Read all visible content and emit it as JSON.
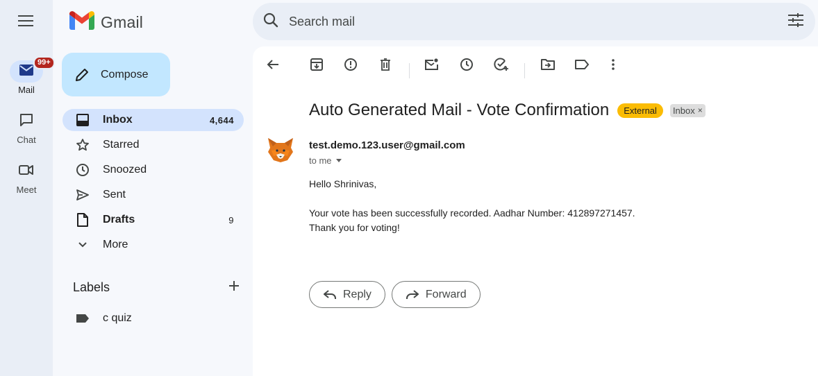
{
  "app": {
    "name": "Gmail",
    "brand_colors": {
      "red": "#ea4335",
      "blue": "#4285f4",
      "green": "#34a853",
      "yellow": "#fbbc04"
    }
  },
  "rail": {
    "menu_icon": "hamburger-menu-icon",
    "items": [
      {
        "label": "Mail",
        "icon": "mail-icon",
        "badge": "99+",
        "active": true
      },
      {
        "label": "Chat",
        "icon": "chat-icon"
      },
      {
        "label": "Meet",
        "icon": "video-camera-icon"
      }
    ]
  },
  "search": {
    "placeholder": "Search mail",
    "icon": "search-icon",
    "filter_icon": "filter-sliders-icon"
  },
  "compose": {
    "label": "Compose",
    "icon": "pencil-icon"
  },
  "nav": {
    "items": [
      {
        "label": "Inbox",
        "count": "4,644",
        "icon": "inbox-icon",
        "active": true
      },
      {
        "label": "Starred",
        "count": "",
        "icon": "star-icon"
      },
      {
        "label": "Snoozed",
        "count": "",
        "icon": "clock-icon"
      },
      {
        "label": "Sent",
        "count": "",
        "icon": "send-icon"
      },
      {
        "label": "Drafts",
        "count": "9",
        "icon": "draft-file-icon"
      },
      {
        "label": "More",
        "count": "",
        "icon": "chevron-down-icon"
      }
    ]
  },
  "labels": {
    "heading": "Labels",
    "add_icon": "plus-icon",
    "items": [
      {
        "label": "c quiz",
        "icon": "label-tag-icon"
      }
    ]
  },
  "toolbar": {
    "icons": [
      "back-arrow-icon",
      "archive-icon",
      "report-spam-icon",
      "delete-icon",
      "mark-unread-icon",
      "snooze-icon",
      "add-to-tasks-icon",
      "move-to-icon",
      "label-icon",
      "more-vert-icon"
    ]
  },
  "email": {
    "subject": "Auto Generated Mail - Vote Confirmation",
    "tags": {
      "external": "External",
      "inbox": "Inbox",
      "inbox_remove": "×"
    },
    "sender": "test.demo.123.user@gmail.com",
    "to": "to me",
    "body": {
      "greeting": "Hello Shrinivas,",
      "line1": "Your vote has been successfully recorded. Aadhar Number: 412897271457.",
      "line2": "Thank you for voting!"
    },
    "reply_label": "Reply",
    "forward_label": "Forward"
  }
}
